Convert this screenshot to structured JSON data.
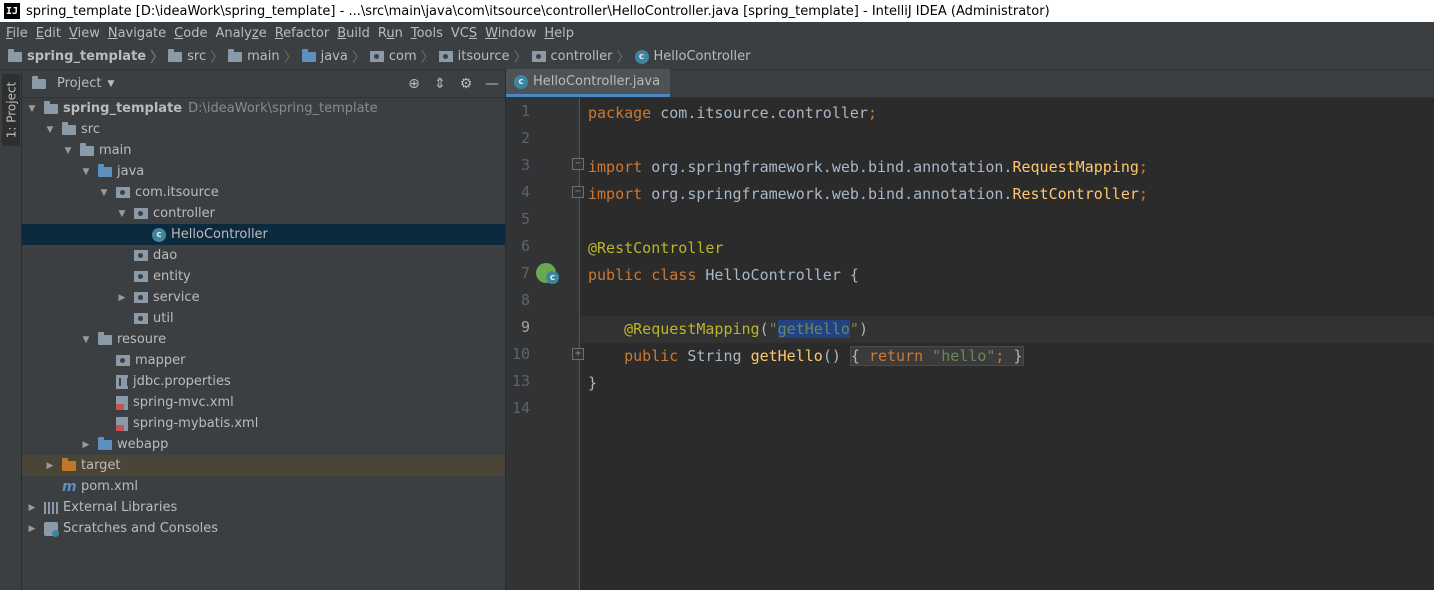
{
  "window": {
    "app_icon_text": "IJ",
    "title": "spring_template [D:\\ideaWork\\spring_template] - ...\\src\\main\\java\\com\\itsource\\controller\\HelloController.java [spring_template] - IntelliJ IDEA (Administrator)"
  },
  "menu": [
    {
      "u": "F",
      "rest": "ile"
    },
    {
      "u": "E",
      "rest": "dit"
    },
    {
      "u": "V",
      "rest": "iew"
    },
    {
      "u": "N",
      "rest": "avigate"
    },
    {
      "u": "C",
      "rest": "ode"
    },
    {
      "pre": "Analy",
      "u": "z",
      "rest": "e"
    },
    {
      "u": "R",
      "rest": "efactor"
    },
    {
      "u": "B",
      "rest": "uild"
    },
    {
      "pre": "R",
      "u": "u",
      "rest": "n"
    },
    {
      "u": "T",
      "rest": "ools"
    },
    {
      "pre": "VC",
      "u": "S",
      "rest": ""
    },
    {
      "u": "W",
      "rest": "indow"
    },
    {
      "u": "H",
      "rest": "elp"
    }
  ],
  "breadcrumbs": [
    "spring_template",
    "src",
    "main",
    "java",
    "com",
    "itsource",
    "controller",
    "HelloController"
  ],
  "tool_window": {
    "tab_label": "1: Project",
    "header_label": "Project"
  },
  "tree": [
    {
      "label": "spring_template",
      "path": "D:\\ideaWork\\spring_template",
      "expanded": true
    },
    {
      "label": "src",
      "expanded": true
    },
    {
      "label": "main",
      "expanded": true
    },
    {
      "label": "java",
      "expanded": true
    },
    {
      "label": "com.itsource",
      "expanded": true
    },
    {
      "label": "controller",
      "expanded": true
    },
    {
      "label": "HelloController",
      "selected": true
    },
    {
      "label": "dao"
    },
    {
      "label": "entity"
    },
    {
      "label": "service",
      "expanded": false
    },
    {
      "label": "util"
    },
    {
      "label": "resoure",
      "expanded": true
    },
    {
      "label": "mapper"
    },
    {
      "label": "jdbc.properties"
    },
    {
      "label": "spring-mvc.xml"
    },
    {
      "label": "spring-mybatis.xml"
    },
    {
      "label": "webapp",
      "expanded": false
    },
    {
      "label": "target",
      "expanded": false,
      "highlighted": true
    },
    {
      "label": "pom.xml"
    },
    {
      "label": "External Libraries",
      "expanded": false
    },
    {
      "label": "Scratches and Consoles",
      "expanded": false
    }
  ],
  "editor": {
    "tab_label": "HelloController.java",
    "tab_close": "×",
    "current_line": 9,
    "line_numbers": [
      "1",
      "2",
      "3",
      "4",
      "5",
      "6",
      "7",
      "8",
      "9",
      "10",
      "13",
      "14"
    ],
    "code": {
      "l1_kw": "package",
      "l1_rest": " com.itsource.controller",
      "l1_semi": ";",
      "l3_kw": "import",
      "l3_pkg": " org.springframework.web.bind.annotation.",
      "l3_cls": "RequestMapping",
      "l3_semi": ";",
      "l4_kw": "import",
      "l4_pkg": " org.springframework.web.bind.annotation.",
      "l4_cls": "RestController",
      "l4_semi": ";",
      "l6_ann": "@RestController",
      "l7_kw": "public class",
      "l7_rest": " HelloController {",
      "l9_ann": "@RequestMapping",
      "l9_paren_open": "(",
      "l9_quote_open": "\"",
      "l9_value": "getHello",
      "l9_quote_close": "\"",
      "l9_paren_close": ")",
      "l10_kw": "public",
      "l10_type": " String ",
      "l10_fn": "getHello",
      "l10_parens": "() ",
      "l10_brace_open": "{ ",
      "l10_return": "return",
      "l10_str": " \"hello\"",
      "l10_semi": ";",
      "l10_brace_close": " }",
      "l13_brace": "}"
    }
  }
}
